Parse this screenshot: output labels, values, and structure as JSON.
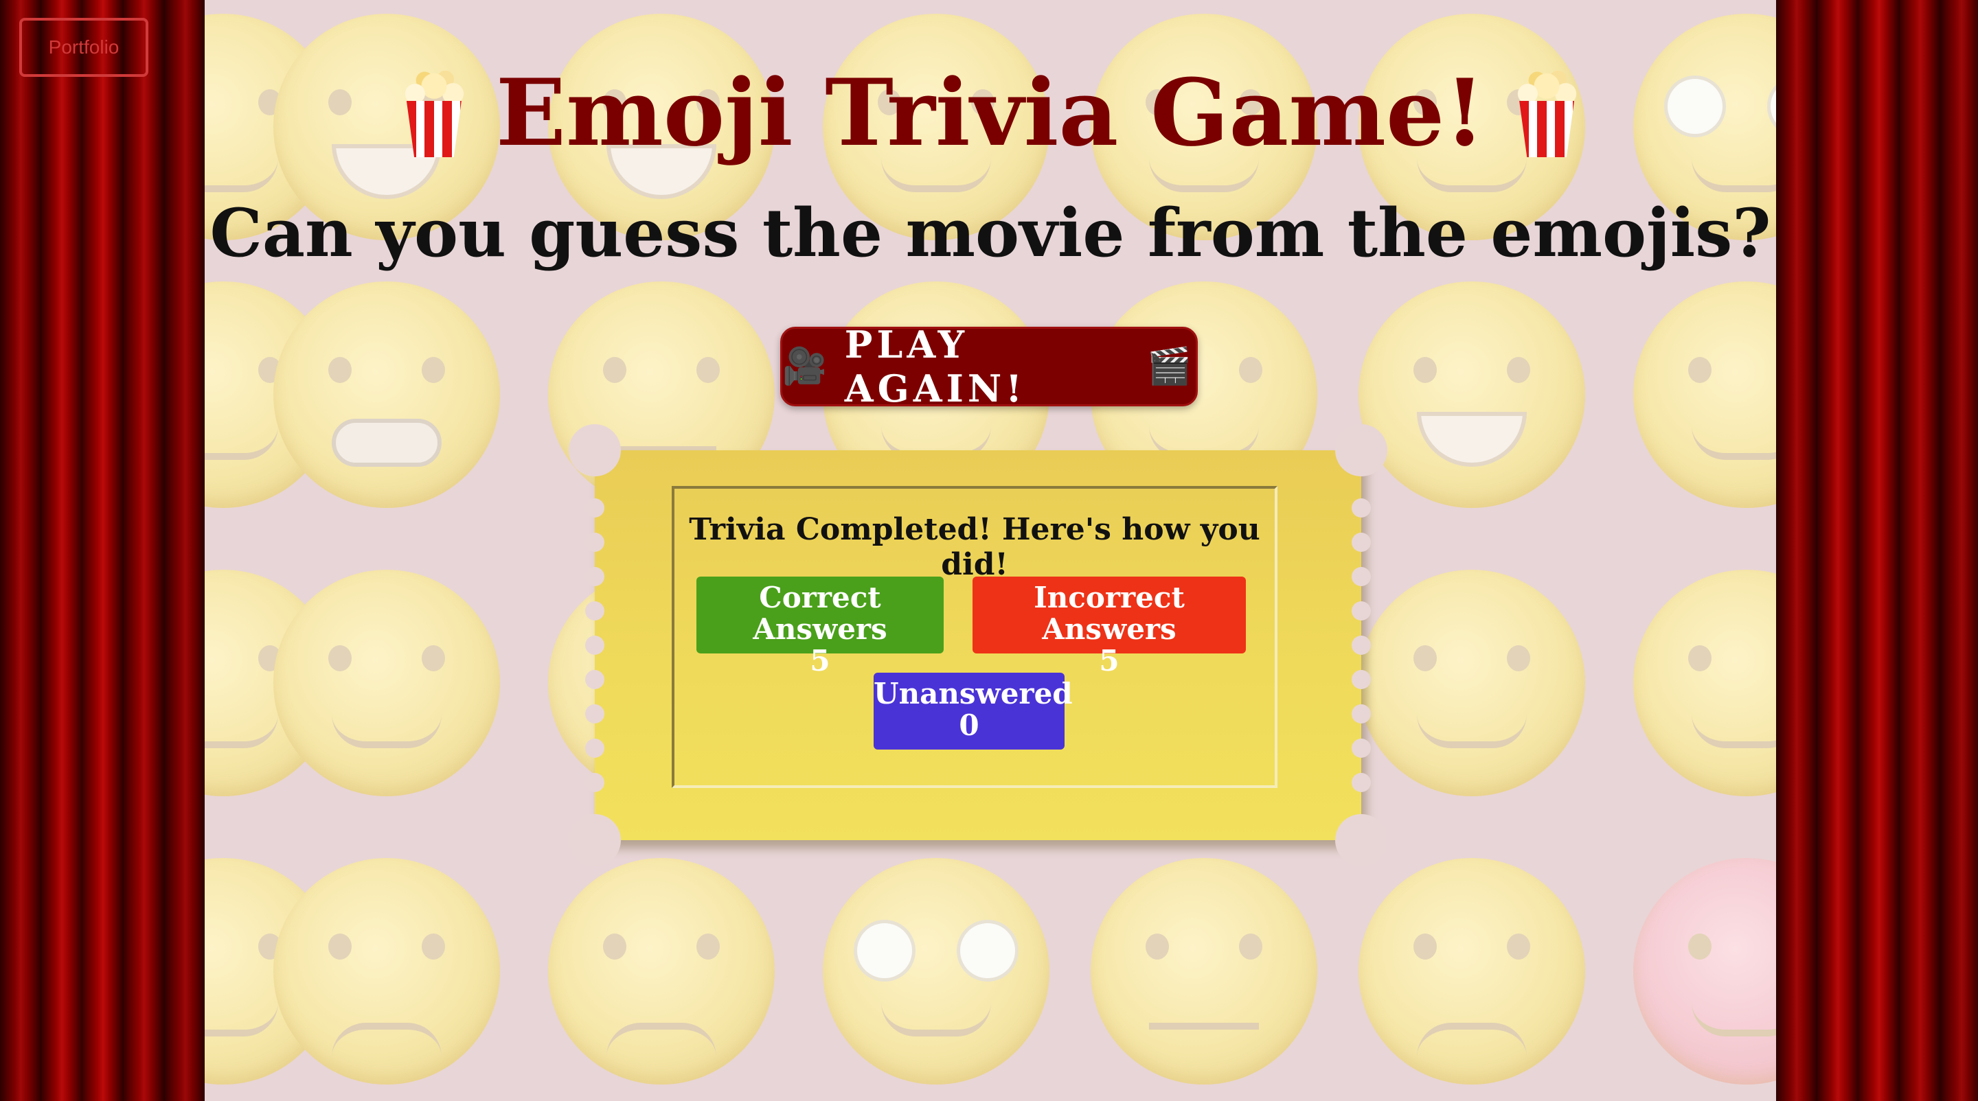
{
  "nav": {
    "portfolio_label": "Portfolio"
  },
  "header": {
    "title": "Emoji Trivia Game!",
    "subtitle": "Can you guess the movie from the emojis?"
  },
  "play_button": {
    "label": "PLAY AGAIN!"
  },
  "results": {
    "heading": "Trivia Completed! Here's how you did!",
    "correct": {
      "label": "Correct Answers",
      "value": "5"
    },
    "incorrect": {
      "label": "Incorrect Answers",
      "value": "5"
    },
    "unanswered": {
      "label": "Unanswered",
      "value": "0"
    }
  },
  "colors": {
    "title": "#7a0000",
    "button_bg": "#7d0000",
    "correct": "#4aa01a",
    "incorrect": "#ee3217",
    "unanswered": "#4a33d6",
    "ticket": "#efd95a",
    "portfolio_border": "#d13a3a"
  },
  "icons": {
    "title_left": "popcorn-icon",
    "title_right": "popcorn-icon",
    "button_left": "movie-camera-icon",
    "button_right": "clapper-board-icon"
  }
}
